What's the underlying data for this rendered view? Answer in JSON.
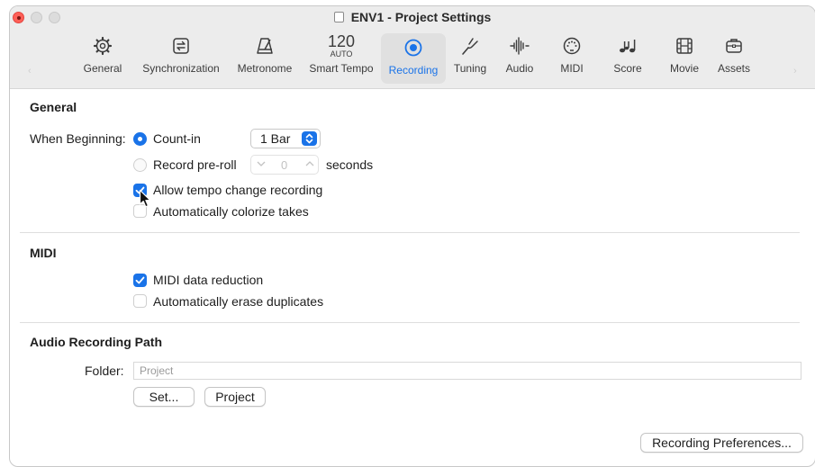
{
  "window": {
    "title": "ENV1 - Project Settings",
    "traffic_lights": [
      "close",
      "minimize",
      "zoom"
    ]
  },
  "toolbar": {
    "tabs": [
      {
        "label": "General",
        "icon": "gear-icon"
      },
      {
        "label": "Synchronization",
        "icon": "sync-icon"
      },
      {
        "label": "Metronome",
        "icon": "metronome-icon"
      },
      {
        "label": "Smart Tempo",
        "icon": "smart-tempo-icon",
        "tempo": "120",
        "tempo_mode": "AUTO"
      },
      {
        "label": "Recording",
        "icon": "record-icon",
        "selected": true
      },
      {
        "label": "Tuning",
        "icon": "tuning-fork-icon"
      },
      {
        "label": "Audio",
        "icon": "waveform-icon"
      },
      {
        "label": "MIDI",
        "icon": "midi-port-icon"
      },
      {
        "label": "Score",
        "icon": "music-notes-icon"
      },
      {
        "label": "Movie",
        "icon": "film-icon"
      },
      {
        "label": "Assets",
        "icon": "briefcase-icon"
      }
    ]
  },
  "general": {
    "title": "General",
    "when_beginning_label": "When Beginning:",
    "count_in_label": "Count-in",
    "count_in_selected": true,
    "count_in_value": "1 Bar",
    "record_preroll_label": "Record pre-roll",
    "record_preroll_selected": false,
    "preroll_value": "0",
    "seconds_label": "seconds",
    "allow_tempo_label": "Allow tempo change recording",
    "allow_tempo_checked": true,
    "auto_colorize_label": "Automatically colorize takes",
    "auto_colorize_checked": false
  },
  "midi": {
    "title": "MIDI",
    "data_reduction_label": "MIDI data reduction",
    "data_reduction_checked": true,
    "erase_duplicates_label": "Automatically erase duplicates",
    "erase_duplicates_checked": false
  },
  "audio_path": {
    "title": "Audio Recording Path",
    "folder_label": "Folder:",
    "folder_placeholder": "Project",
    "set_button": "Set...",
    "project_button": "Project"
  },
  "footer": {
    "preferences_button": "Recording Preferences..."
  },
  "colors": {
    "accent": "#1a73e8",
    "close_light": "#ff5f57"
  }
}
